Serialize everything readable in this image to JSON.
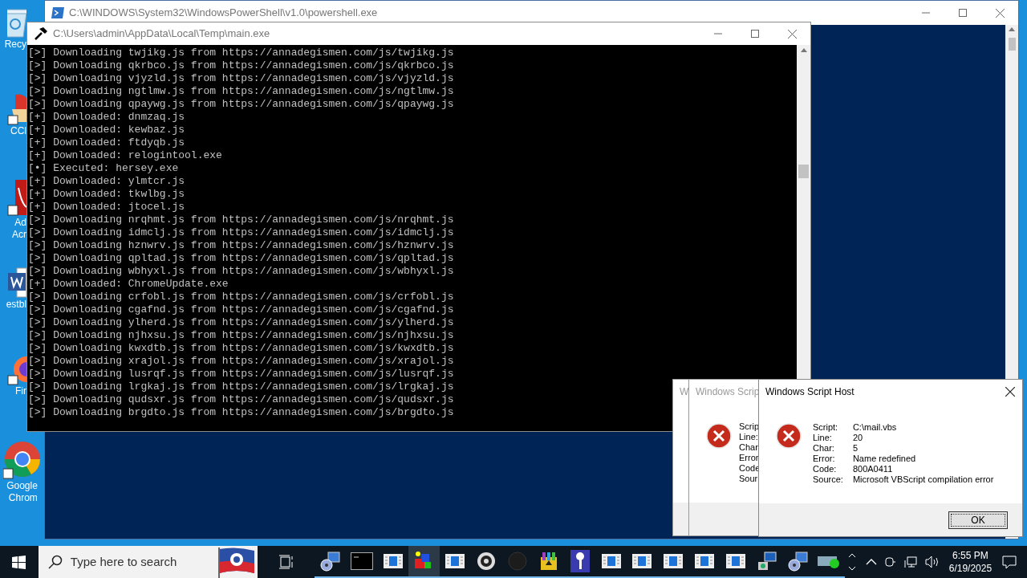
{
  "desktop_icons": [
    {
      "kind": "recycle-bin",
      "label_lines": [
        "Recy"
      ]
    },
    {
      "kind": "ccleaner",
      "label_lines": [
        "CCl"
      ]
    },
    {
      "kind": "acrobat",
      "label_lines": [
        "Ad",
        "Acr"
      ]
    },
    {
      "kind": "word",
      "label_lines": [
        "estbl"
      ]
    },
    {
      "kind": "firefox",
      "label_lines": [
        "Fir"
      ]
    },
    {
      "kind": "chrome",
      "label_lines": [
        "Google",
        "Chrom"
      ]
    }
  ],
  "powershell_window": {
    "title": "C:\\WINDOWS\\System32\\WindowsPowerShell\\v1.0\\powershell.exe"
  },
  "console_window": {
    "title": "C:\\Users\\admin\\AppData\\Local\\Temp\\main.exe",
    "lines": [
      "[>] Downloading twjikg.js from https://annadegismen.com/js/twjikg.js",
      "[>] Downloading qkrbco.js from https://annadegismen.com/js/qkrbco.js",
      "[>] Downloading vjyzld.js from https://annadegismen.com/js/vjyzld.js",
      "[>] Downloading ngtlmw.js from https://annadegismen.com/js/ngtlmw.js",
      "[>] Downloading qpaywg.js from https://annadegismen.com/js/qpaywg.js",
      "[+] Downloaded: dnmzaq.js",
      "[+] Downloaded: kewbaz.js",
      "[+] Downloaded: ftdyqb.js",
      "[+] Downloaded: relogintool.exe",
      "[•] Executed: hersey.exe",
      "[+] Downloaded: ylmtcr.js",
      "[+] Downloaded: tkwlbg.js",
      "[+] Downloaded: jtocel.js",
      "[>] Downloading nrqhmt.js from https://annadegismen.com/js/nrqhmt.js",
      "[>] Downloading idmclj.js from https://annadegismen.com/js/idmclj.js",
      "[>] Downloading hznwrv.js from https://annadegismen.com/js/hznwrv.js",
      "[>] Downloading qpltad.js from https://annadegismen.com/js/qpltad.js",
      "[>] Downloading wbhyxl.js from https://annadegismen.com/js/wbhyxl.js",
      "[+] Downloaded: ChromeUpdate.exe",
      "[>] Downloading crfobl.js from https://annadegismen.com/js/crfobl.js",
      "[>] Downloading cgafnd.js from https://annadegismen.com/js/cgafnd.js",
      "[>] Downloading ylherd.js from https://annadegismen.com/js/ylherd.js",
      "[>] Downloading njhxsu.js from https://annadegismen.com/js/njhxsu.js",
      "[>] Downloading kwxdtb.js from https://annadegismen.com/js/kwxdtb.js",
      "[>] Downloading xrajol.js from https://annadegismen.com/js/xrajol.js",
      "[>] Downloading lusrqf.js from https://annadegismen.com/js/lusrqf.js",
      "[>] Downloading lrgkaj.js from https://annadegismen.com/js/lrgkaj.js",
      "[>] Downloading qudsxr.js from https://annadegismen.com/js/qudsxr.js",
      "[>] Downloading brgdto.js from https://annadegismen.com/js/brgdto.js"
    ]
  },
  "dialogs_behind": [
    {
      "title": "W"
    },
    {
      "title": "Windows Scrip",
      "labels": [
        "Scrip",
        "Line:",
        "Char",
        "Error",
        "Code",
        "Sour"
      ]
    }
  ],
  "dialog": {
    "title": "Windows Script Host",
    "fields": [
      {
        "label": "Script:",
        "value": "C:\\mail.vbs"
      },
      {
        "label": "Line:",
        "value": "20"
      },
      {
        "label": "Char:",
        "value": "5"
      },
      {
        "label": "Error:",
        "value": "Name redefined"
      },
      {
        "label": "Code:",
        "value": "800A0411"
      },
      {
        "label": "Source:",
        "value": "Microsoft VBScript compilation error"
      }
    ],
    "button": "OK"
  },
  "taskbar": {
    "search_placeholder": "Type here to search",
    "apps": [
      {
        "kind": "installer",
        "selected": false
      },
      {
        "kind": "terminal",
        "selected": false
      },
      {
        "kind": "window",
        "selected": false
      },
      {
        "kind": "cubes",
        "selected": true
      },
      {
        "kind": "window",
        "selected": false
      },
      {
        "kind": "disc",
        "selected": false
      },
      {
        "kind": "dark-circle",
        "selected": false
      },
      {
        "kind": "archive",
        "selected": false
      },
      {
        "kind": "key",
        "selected": false
      },
      {
        "kind": "window",
        "selected": false
      },
      {
        "kind": "window",
        "selected": false
      },
      {
        "kind": "window",
        "selected": false
      },
      {
        "kind": "window",
        "selected": false
      },
      {
        "kind": "window",
        "selected": false
      },
      {
        "kind": "computer",
        "selected": false
      },
      {
        "kind": "installer",
        "selected": false
      },
      {
        "kind": "drive",
        "selected": false
      }
    ],
    "time": "6:55 PM",
    "date": "6/19/2025"
  }
}
